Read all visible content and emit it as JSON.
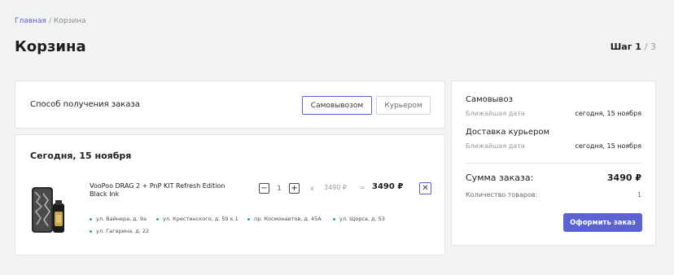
{
  "breadcrumb": {
    "home": "Главная",
    "separator": "/",
    "current": "Корзина"
  },
  "page": {
    "title": "Корзина"
  },
  "step": {
    "label": "Шаг",
    "current": "1",
    "total": "/ 3"
  },
  "delivery": {
    "label": "Способ получения заказа",
    "options": [
      {
        "label": "Самовывозом",
        "selected": true
      },
      {
        "label": "Курьером",
        "selected": false
      }
    ]
  },
  "order": {
    "date_title": "Сегодня, 15 ноября",
    "item": {
      "name": "VooPoo DRAG 2 + PnP KIT Refresh Edition Black Ink",
      "quantity": "1",
      "minus": "−",
      "plus": "+",
      "times": "x",
      "unit_price": "3490 ₽",
      "equals": "=",
      "total_price": "3490 ₽",
      "remove": "✕"
    },
    "stores": [
      "ул. Вайнера, д. 9а",
      "ул. Крестинского, д. 59 к.1",
      "пр. Космонавтов, д. 45А",
      "ул. Щорса, д. 53",
      "ул. Гагарина, д. 22"
    ]
  },
  "summary": {
    "pickup": {
      "title": "Самовывоз",
      "sub": "Ближайшая дата",
      "value": "сегодня, 15 ноября"
    },
    "courier": {
      "title": "Доставка курьером",
      "sub": "Ближайшая дата",
      "value": "сегодня, 15 ноября"
    },
    "total_label": "Сумма заказа:",
    "total_value": "3490 ₽",
    "count_label": "Количество товаров:",
    "count_value": "1",
    "checkout": "Оформить заказ"
  },
  "colors": {
    "accent": "#5b63d3",
    "store_dot": "#22b573",
    "background": "#f2f3f5"
  }
}
